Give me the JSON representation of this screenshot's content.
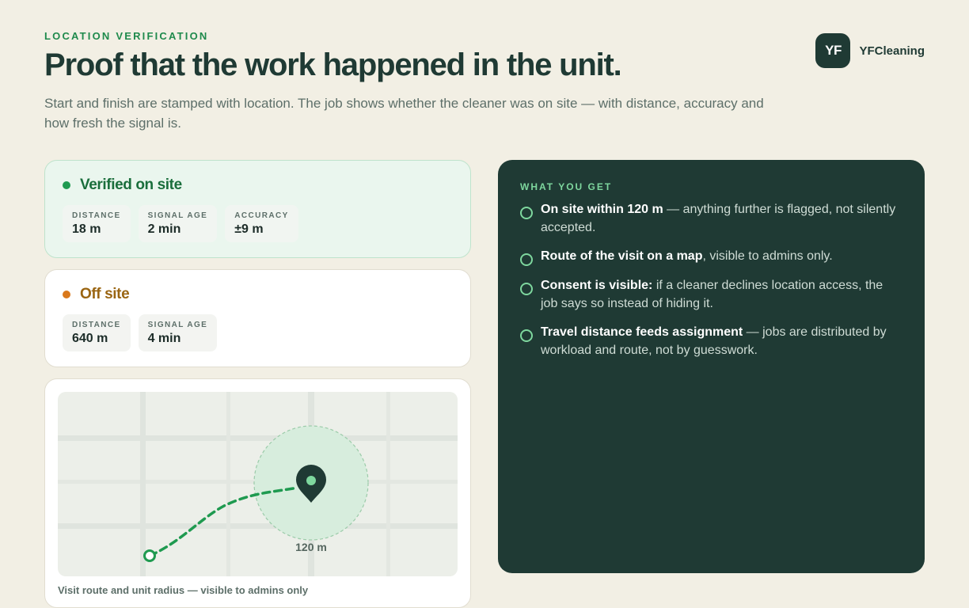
{
  "header": {
    "eyebrow": "LOCATION VERIFICATION",
    "title": "Proof that the work happened in the unit.",
    "subtitle": "Start and finish are stamped with location. The job shows whether the cleaner was on site — with distance, accuracy and how fresh the signal is."
  },
  "brand": {
    "logo_text": "YF",
    "name": "YFCleaning"
  },
  "verified_card": {
    "status": "Verified on site",
    "metrics": [
      {
        "label": "DISTANCE",
        "value": "18 m"
      },
      {
        "label": "SIGNAL AGE",
        "value": "2 min"
      },
      {
        "label": "ACCURACY",
        "value": "±9 m"
      }
    ]
  },
  "offsite_card": {
    "status": "Off site",
    "metrics": [
      {
        "label": "DISTANCE",
        "value": "640 m"
      },
      {
        "label": "SIGNAL AGE",
        "value": "4 min"
      }
    ]
  },
  "map_card": {
    "radius_label": "120 m",
    "caption": "Visit route and unit radius — visible to admins only"
  },
  "benefits": {
    "eyebrow": "WHAT YOU GET",
    "items": [
      {
        "strong": "On site within 120 m",
        "rest": " — anything further is flagged, not silently accepted."
      },
      {
        "strong": "Route of the visit on a map",
        "rest": ", visible to admins only."
      },
      {
        "strong": "Consent is visible:",
        "rest": " if a cleaner declines location access, the job says so instead of hiding it."
      },
      {
        "strong": "Travel distance feeds assignment",
        "rest": " — jobs are distributed by workload and route, not by guesswork."
      }
    ]
  },
  "colors": {
    "background": "#f2efe4",
    "primary_dark": "#1f3a34",
    "accent_green": "#1f9a50",
    "warning_orange": "#d9781b"
  }
}
